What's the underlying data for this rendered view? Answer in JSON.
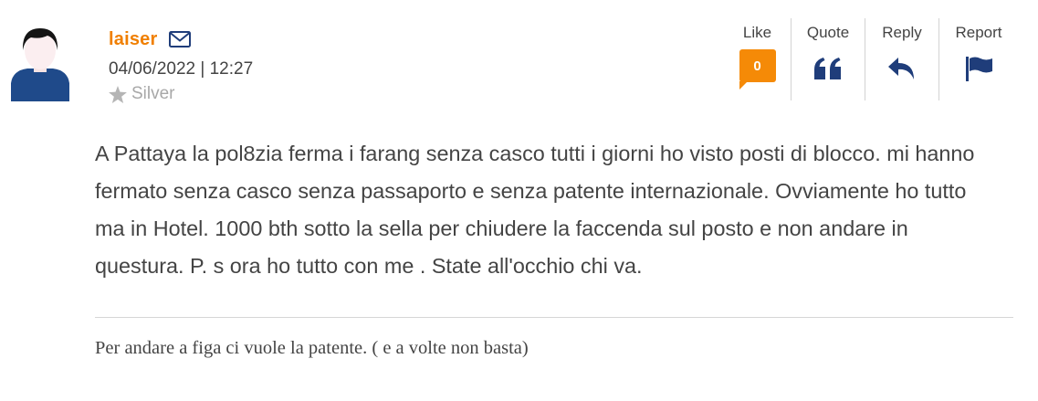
{
  "author": {
    "username": "laiser",
    "datetime": "04/06/2022 | 12:27",
    "rank": "Silver"
  },
  "actions": {
    "like_label": "Like",
    "like_count": "0",
    "quote_label": "Quote",
    "reply_label": "Reply",
    "report_label": "Report"
  },
  "post": {
    "body": "A Pattaya la pol8zia ferma i farang senza casco tutti i giorni ho visto posti di blocco. mi hanno fermato senza casco senza passaporto e senza patente internazionale. Ovviamente ho tutto ma in Hotel. 1000 bth sotto la sella per chiudere la faccenda sul posto e non andare in questura. P. s ora ho tutto con me . State all'occhio chi va.",
    "signature": "Per andare a figa ci vuole la patente. ( e a volte non basta)"
  },
  "colors": {
    "accent_orange": "#f07f00",
    "icon_blue": "#1f3d7a",
    "badge_orange": "#f58a07"
  },
  "icons": {
    "avatar": "user-avatar-icon",
    "mail": "envelope-icon",
    "rank": "star-icon",
    "quote": "quote-icon",
    "reply": "reply-arrow-icon",
    "report": "flag-icon"
  }
}
